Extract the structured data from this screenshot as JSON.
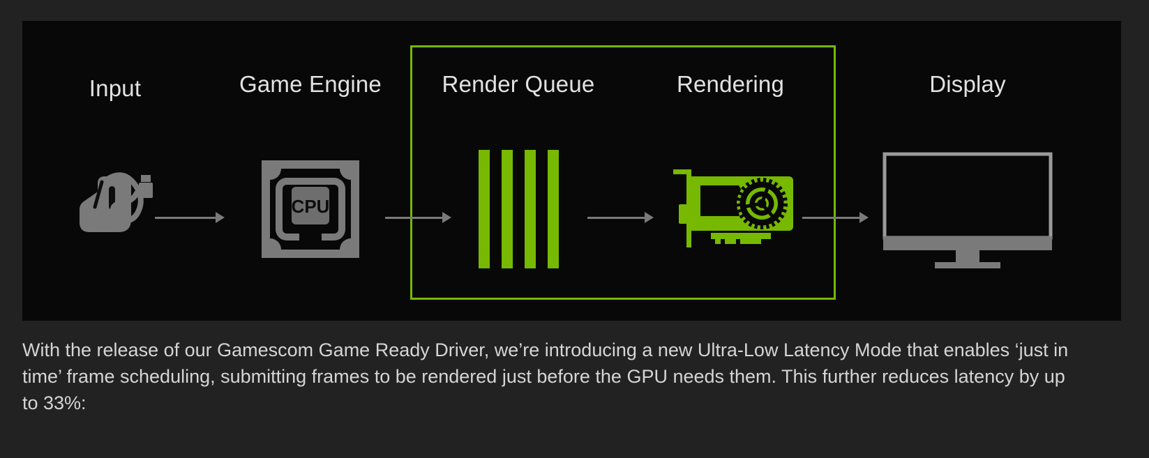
{
  "page": {
    "background_color": "#222222",
    "accent_color": "#76b900",
    "panel_color": "#080808",
    "text_color": "#d5d5d5",
    "top_clipped_line": ""
  },
  "diagram": {
    "name": "rendering-pipeline-diagram",
    "highlight_label": "Render Queue and Rendering highlighted",
    "stages": [
      {
        "id": "input",
        "label": "Input",
        "icon": "mouse-icon",
        "icon_color": "#7a7a7a"
      },
      {
        "id": "engine",
        "label": "Game Engine",
        "icon": "cpu-chip-icon",
        "icon_color": "#7a7a7a"
      },
      {
        "id": "queue",
        "label": "Render Queue",
        "icon": "queue-bars-icon",
        "icon_color": "#76b900"
      },
      {
        "id": "render",
        "label": "Rendering",
        "icon": "gpu-card-icon",
        "icon_color": "#76b900"
      },
      {
        "id": "display",
        "label": "Display",
        "icon": "monitor-icon",
        "icon_color": "#7a7a7a"
      }
    ],
    "arrows": [
      {
        "id": "arrow-input-to-engine"
      },
      {
        "id": "arrow-engine-to-queue"
      },
      {
        "id": "arrow-queue-to-render"
      },
      {
        "id": "arrow-render-to-display"
      }
    ],
    "queue_bar_count": 4,
    "cpu_chip_text": "CPU"
  },
  "caption": {
    "text": "With the release of our Gamescom Game Ready Driver, we’re introducing a new Ultra-Low Latency Mode that enables ‘just in time’ frame scheduling, submitting frames to be rendered just before the GPU needs them. This further reduces latency by up to 33%:"
  }
}
